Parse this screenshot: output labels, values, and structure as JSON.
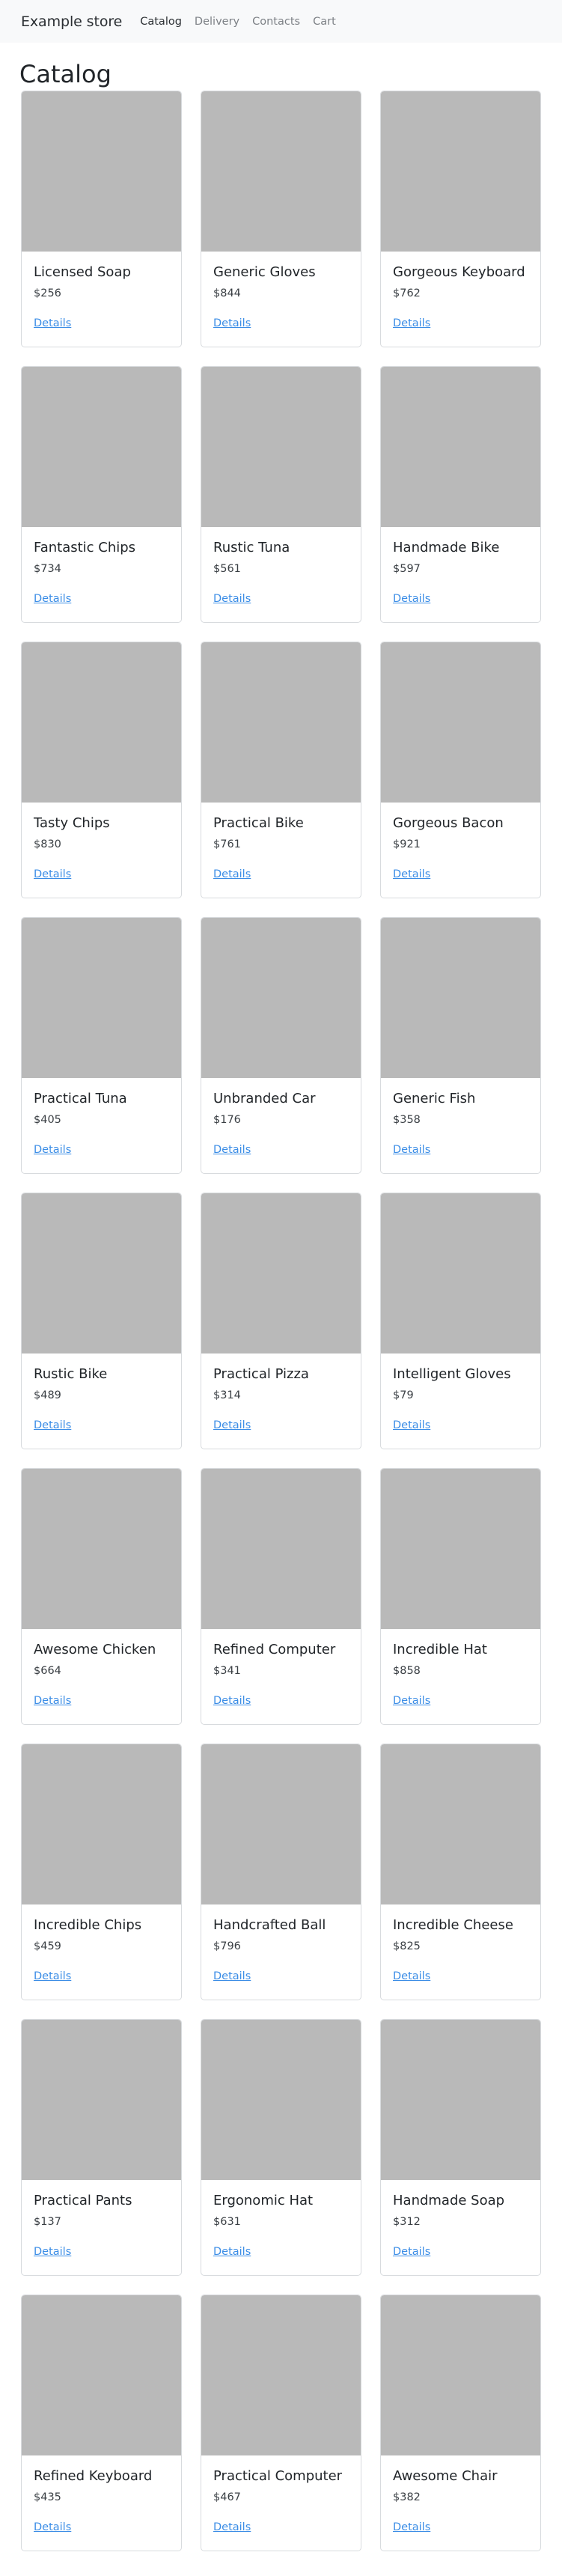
{
  "navbar": {
    "brand": "Example store",
    "links": [
      {
        "label": "Catalog",
        "active": true
      },
      {
        "label": "Delivery",
        "active": false
      },
      {
        "label": "Contacts",
        "active": false
      },
      {
        "label": "Cart",
        "active": false
      }
    ]
  },
  "page": {
    "title": "Catalog"
  },
  "details_label": "Details",
  "products": [
    {
      "name": "Licensed Soap",
      "price": "$256"
    },
    {
      "name": "Generic Gloves",
      "price": "$844"
    },
    {
      "name": "Gorgeous Keyboard",
      "price": "$762"
    },
    {
      "name": "Fantastic Chips",
      "price": "$734"
    },
    {
      "name": "Rustic Tuna",
      "price": "$561"
    },
    {
      "name": "Handmade Bike",
      "price": "$597"
    },
    {
      "name": "Tasty Chips",
      "price": "$830"
    },
    {
      "name": "Practical Bike",
      "price": "$761"
    },
    {
      "name": "Gorgeous Bacon",
      "price": "$921"
    },
    {
      "name": "Practical Tuna",
      "price": "$405"
    },
    {
      "name": "Unbranded Car",
      "price": "$176"
    },
    {
      "name": "Generic Fish",
      "price": "$358"
    },
    {
      "name": "Rustic Bike",
      "price": "$489"
    },
    {
      "name": "Practical Pizza",
      "price": "$314"
    },
    {
      "name": "Intelligent Gloves",
      "price": "$79"
    },
    {
      "name": "Awesome Chicken",
      "price": "$664"
    },
    {
      "name": "Refined Computer",
      "price": "$341"
    },
    {
      "name": "Incredible Hat",
      "price": "$858"
    },
    {
      "name": "Incredible Chips",
      "price": "$459"
    },
    {
      "name": "Handcrafted Ball",
      "price": "$796"
    },
    {
      "name": "Incredible Cheese",
      "price": "$825"
    },
    {
      "name": "Practical Pants",
      "price": "$137"
    },
    {
      "name": "Ergonomic Hat",
      "price": "$631"
    },
    {
      "name": "Handmade Soap",
      "price": "$312"
    },
    {
      "name": "Refined Keyboard",
      "price": "$435"
    },
    {
      "name": "Practical Computer",
      "price": "$467"
    },
    {
      "name": "Awesome Chair",
      "price": "$382"
    }
  ]
}
